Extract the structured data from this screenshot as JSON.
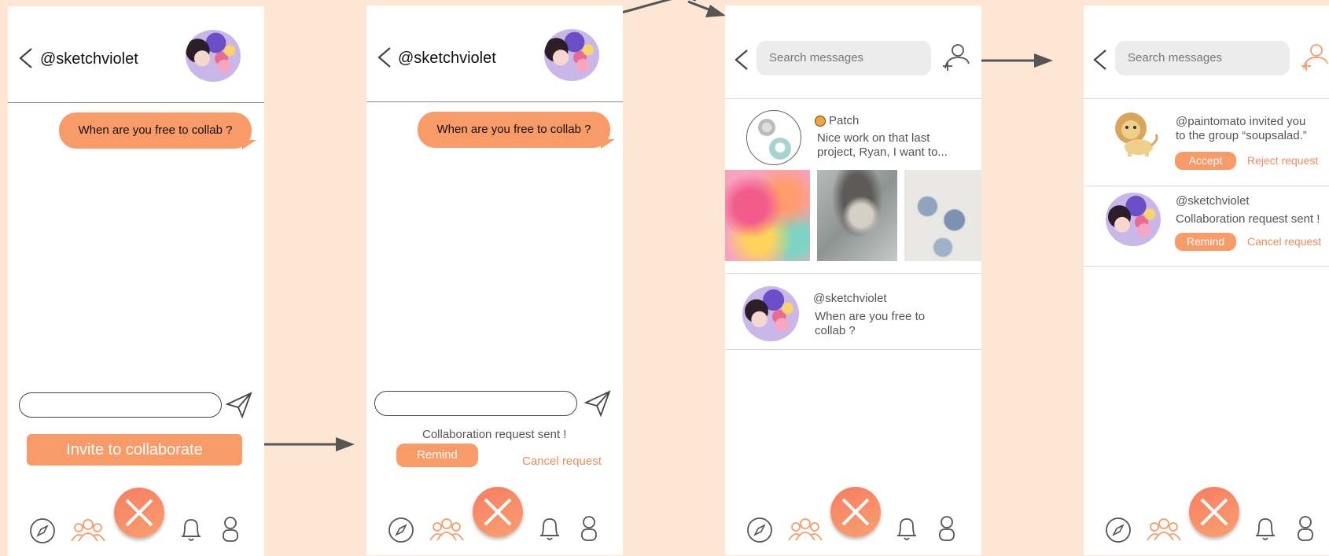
{
  "colors": {
    "accent": "#f99b68",
    "background": "#fde6d3",
    "link": "#f08a5c"
  },
  "screen1": {
    "handle": "@sketchviolet",
    "bubble": "When are you free to collab ?",
    "invite_button": "Invite to collaborate"
  },
  "screen2": {
    "handle": "@sketchviolet",
    "bubble": "When are you free to collab ?",
    "status": "Collaboration request sent !",
    "remind": "Remind",
    "cancel": "Cancel request"
  },
  "screen3": {
    "search_placeholder": "Search messages",
    "conversations": [
      {
        "name": "Patch",
        "preview_line1": "Nice work on that last",
        "preview_line2": "project, Ryan, I want to..."
      },
      {
        "name": "@sketchviolet",
        "preview_line1": "When are you free to",
        "preview_line2": "collab ?"
      }
    ]
  },
  "screen4": {
    "search_placeholder": "Search messages",
    "requests": [
      {
        "line1": "@paintomato invited you",
        "line2": "to the group “soupsalad.”",
        "primary": "Accept",
        "secondary": "Reject request"
      },
      {
        "line1": "@sketchviolet",
        "line2": "Collaboration request sent !",
        "primary": "Remind",
        "secondary": "Cancel request"
      }
    ]
  },
  "icons": [
    "back-icon",
    "send-icon",
    "compass-icon",
    "community-icon",
    "create-icon",
    "bell-icon",
    "profile-icon",
    "add-user-icon"
  ]
}
